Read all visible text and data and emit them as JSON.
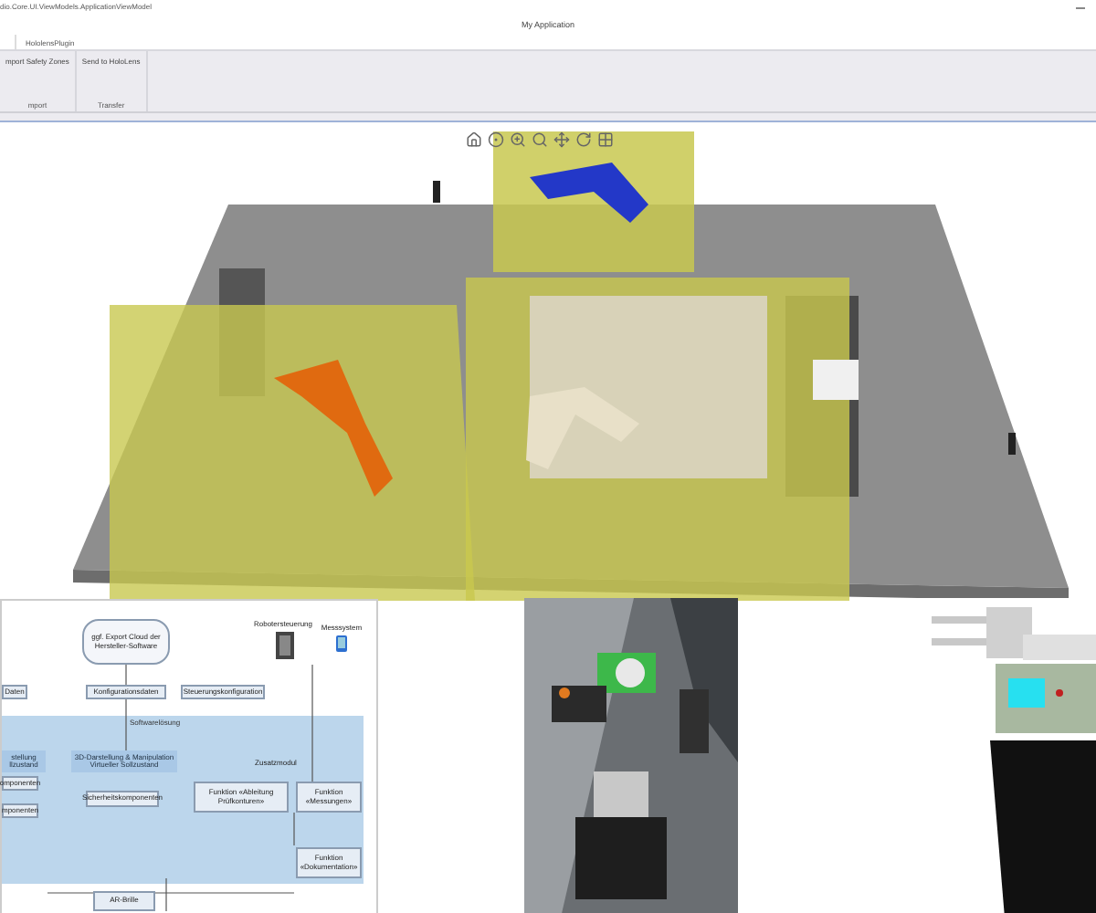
{
  "window": {
    "title": "dio.Core.UI.ViewModels.ApplicationViewModel",
    "app_title": "My Application"
  },
  "tabs": [
    {
      "label": "HololensPlugin",
      "selected": false
    }
  ],
  "ribbon_groups": [
    {
      "button": "mport Safety Zones",
      "label": "mport"
    },
    {
      "button": "Send to HoloLens",
      "label": "Transfer"
    }
  ],
  "diagram": {
    "band_title": "Softwarelösung",
    "nodes": [
      {
        "kind": "cloud",
        "text": "ggf. Export Cloud der Hersteller-Software"
      },
      {
        "kind": "box",
        "text": "Daten"
      },
      {
        "kind": "box",
        "text": "Konfigurationsdaten"
      },
      {
        "kind": "box",
        "text": "Steuerungskonfiguration"
      },
      {
        "kind": "label",
        "text": "Robotersteuerung"
      },
      {
        "kind": "label",
        "text": "Messsystem"
      },
      {
        "kind": "header",
        "text": "stellung llzustand"
      },
      {
        "kind": "header",
        "text": "3D-Darstellung & Manipulation Virtueller Sollzustand"
      },
      {
        "kind": "box",
        "text": "omponenten"
      },
      {
        "kind": "box",
        "text": "mponenten"
      },
      {
        "kind": "box",
        "text": "Sicherheitskomponenten"
      },
      {
        "kind": "label",
        "text": "Zusatzmodul"
      },
      {
        "kind": "box",
        "text": "Funktion «Ableitung Prüfkonturen»"
      },
      {
        "kind": "box",
        "text": "Funktion «Messungen»"
      },
      {
        "kind": "box",
        "text": "Funktion «Dokumentation»"
      },
      {
        "kind": "box",
        "text": "AR-Brille"
      }
    ]
  }
}
